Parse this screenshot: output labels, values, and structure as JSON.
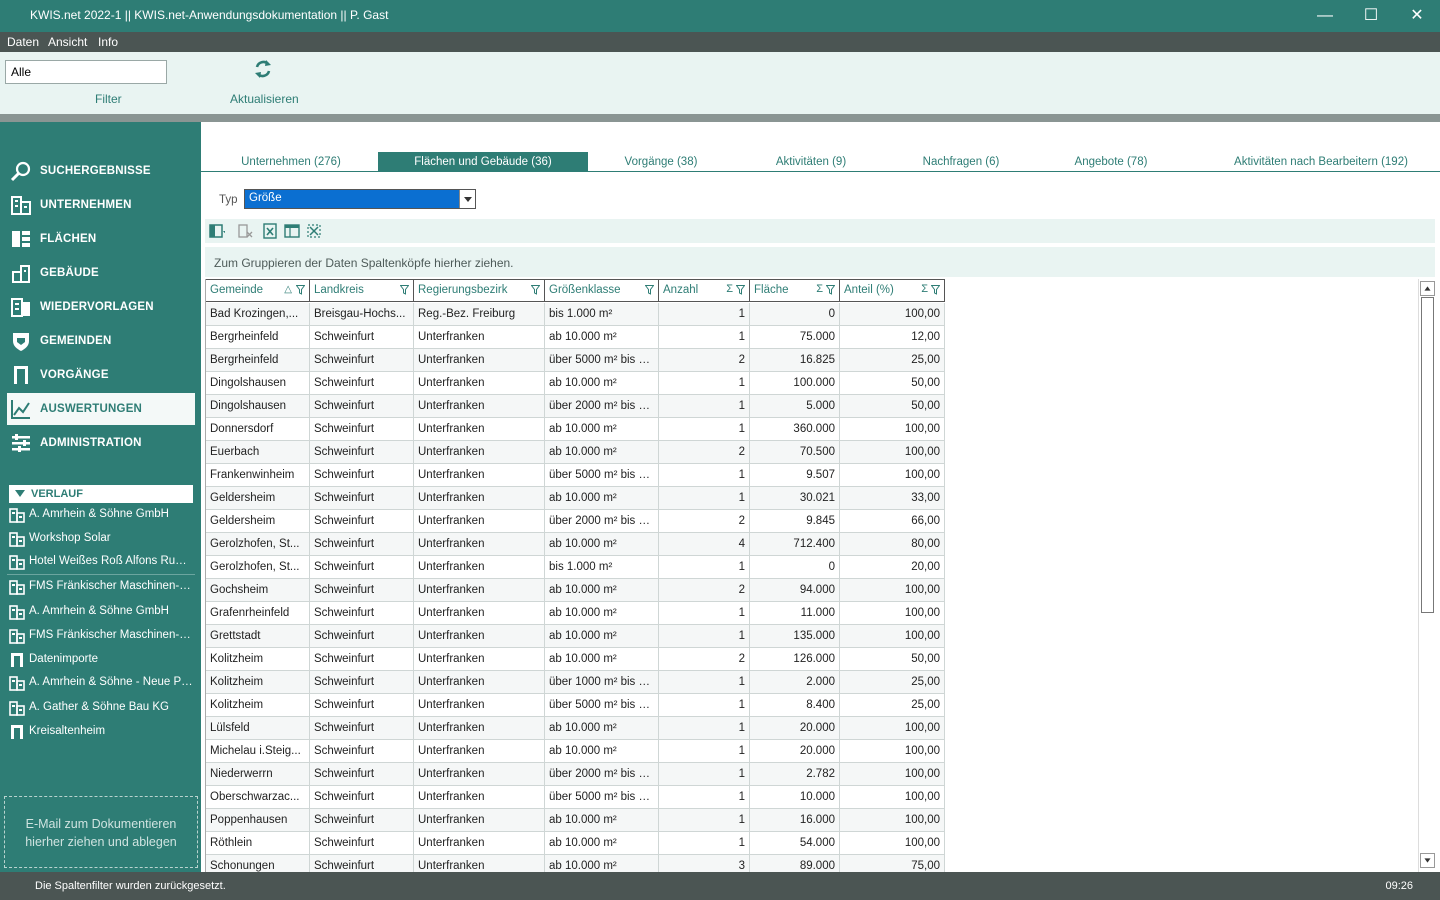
{
  "window": {
    "title": "KWIS.net 2022-1 || KWIS.net-Anwendungsdokumentation || P. Gast",
    "minimize": "—",
    "maximize": "☐",
    "close": "✕"
  },
  "menu": [
    "Daten",
    "Ansicht",
    "Info"
  ],
  "ribbon": {
    "filter_value": "Alle",
    "filter_label": "Filter",
    "refresh_label": "Aktualisieren",
    "refresh_icon": "refresh-icon"
  },
  "nav": [
    {
      "label": "SUCHERGEBNISSE",
      "icon": "search-icon"
    },
    {
      "label": "UNTERNEHMEN",
      "icon": "building-icon"
    },
    {
      "label": "FLÄCHEN",
      "icon": "area-icon"
    },
    {
      "label": "GEBÄUDE",
      "icon": "house-icon"
    },
    {
      "label": "WIEDERVORLAGEN",
      "icon": "resubmission-icon"
    },
    {
      "label": "GEMEINDEN",
      "icon": "crest-icon"
    },
    {
      "label": "VORGÄNGE",
      "icon": "door-icon"
    },
    {
      "label": "AUSWERTUNGEN",
      "icon": "chart-icon",
      "active": true
    },
    {
      "label": "ADMINISTRATION",
      "icon": "sliders-icon"
    }
  ],
  "history": {
    "title": "VERLAUF",
    "items": [
      {
        "label": "A. Amrhein & Söhne GmbH",
        "icon": "company-icon"
      },
      {
        "label": "Workshop Solar",
        "icon": "company-icon"
      },
      {
        "label": "Hotel Weißes Roß Alfons Rudlof",
        "icon": "company-icon"
      },
      {
        "label": "FMS Fränkischer Maschinen- und",
        "icon": "company-icon"
      },
      {
        "label": "A. Amrhein & Söhne GmbH",
        "icon": "company-icon"
      },
      {
        "label": "FMS Fränkischer Maschinen- und",
        "icon": "company-icon"
      },
      {
        "label": "Datenimporte",
        "icon": "door-icon"
      },
      {
        "label": "A. Amrhein & Söhne - Neue Projekte",
        "icon": "company-icon"
      },
      {
        "label": "A. Gather & Söhne Bau KG",
        "icon": "company-icon"
      },
      {
        "label": "Kreisaltenheim",
        "icon": "door-icon"
      }
    ]
  },
  "dropzone_text": "E-Mail  zum Dokumentieren hierher ziehen und ablegen",
  "tabs": [
    {
      "label": "Unternehmen (276)"
    },
    {
      "label": "Flächen und Gebäude (36)",
      "active": true
    },
    {
      "label": "Vorgänge (38)"
    },
    {
      "label": "Aktivitäten (9)"
    },
    {
      "label": "Nachfragen (6)"
    },
    {
      "label": "Angebote (78)"
    },
    {
      "label": "Aktivitäten nach Bearbeitern (192)"
    }
  ],
  "typ": {
    "label": "Typ",
    "value": "Größe"
  },
  "grid_toolbar_icons": [
    "column-chooser-icon",
    "clear-filter-icon",
    "excel-export-icon",
    "layout-icon",
    "fit-columns-icon"
  ],
  "groupbar_text": "Zum Gruppieren der Daten Spaltenköpfe hierher ziehen.",
  "columns": [
    {
      "label": "Gemeinde",
      "sort": "△"
    },
    {
      "label": "Landkreis"
    },
    {
      "label": "Regierungsbezirk"
    },
    {
      "label": "Größenklasse"
    },
    {
      "label": "Anzahl",
      "sum": "Σ"
    },
    {
      "label": "Fläche",
      "sum": "Σ"
    },
    {
      "label": "Anteil (%)",
      "sum": "Σ"
    }
  ],
  "rows": [
    [
      "Bad Krozingen,...",
      "Breisgau-Hochs...",
      "Reg.-Bez. Freiburg",
      "bis 1.000 m²",
      "1",
      "0",
      "100,00"
    ],
    [
      "Bergrheinfeld",
      "Schweinfurt",
      "Unterfranken",
      "ab 10.000 m²",
      "1",
      "75.000",
      "12,00"
    ],
    [
      "Bergrheinfeld",
      "Schweinfurt",
      "Unterfranken",
      "über 5000 m² bis 1...",
      "2",
      "16.825",
      "25,00"
    ],
    [
      "Dingolshausen",
      "Schweinfurt",
      "Unterfranken",
      "ab 10.000 m²",
      "1",
      "100.000",
      "50,00"
    ],
    [
      "Dingolshausen",
      "Schweinfurt",
      "Unterfranken",
      "über 2000 m² bis 5...",
      "1",
      "5.000",
      "50,00"
    ],
    [
      "Donnersdorf",
      "Schweinfurt",
      "Unterfranken",
      "ab 10.000 m²",
      "1",
      "360.000",
      "100,00"
    ],
    [
      "Euerbach",
      "Schweinfurt",
      "Unterfranken",
      "ab 10.000 m²",
      "2",
      "70.500",
      "100,00"
    ],
    [
      "Frankenwinheim",
      "Schweinfurt",
      "Unterfranken",
      "über 5000 m² bis 1...",
      "1",
      "9.507",
      "100,00"
    ],
    [
      "Geldersheim",
      "Schweinfurt",
      "Unterfranken",
      "ab 10.000 m²",
      "1",
      "30.021",
      "33,00"
    ],
    [
      "Geldersheim",
      "Schweinfurt",
      "Unterfranken",
      "über 2000 m² bis 5...",
      "2",
      "9.845",
      "66,00"
    ],
    [
      "Gerolzhofen, St...",
      "Schweinfurt",
      "Unterfranken",
      "ab 10.000 m²",
      "4",
      "712.400",
      "80,00"
    ],
    [
      "Gerolzhofen, St...",
      "Schweinfurt",
      "Unterfranken",
      "bis 1.000 m²",
      "1",
      "0",
      "20,00"
    ],
    [
      "Gochsheim",
      "Schweinfurt",
      "Unterfranken",
      "ab 10.000 m²",
      "2",
      "94.000",
      "100,00"
    ],
    [
      "Grafenrheinfeld",
      "Schweinfurt",
      "Unterfranken",
      "ab 10.000 m²",
      "1",
      "11.000",
      "100,00"
    ],
    [
      "Grettstadt",
      "Schweinfurt",
      "Unterfranken",
      "ab 10.000 m²",
      "1",
      "135.000",
      "100,00"
    ],
    [
      "Kolitzheim",
      "Schweinfurt",
      "Unterfranken",
      "ab 10.000 m²",
      "2",
      "126.000",
      "50,00"
    ],
    [
      "Kolitzheim",
      "Schweinfurt",
      "Unterfranken",
      "über 1000 m² bis 2...",
      "1",
      "2.000",
      "25,00"
    ],
    [
      "Kolitzheim",
      "Schweinfurt",
      "Unterfranken",
      "über 5000 m² bis 1...",
      "1",
      "8.400",
      "25,00"
    ],
    [
      "Lülsfeld",
      "Schweinfurt",
      "Unterfranken",
      "ab 10.000 m²",
      "1",
      "20.000",
      "100,00"
    ],
    [
      "Michelau i.Steig...",
      "Schweinfurt",
      "Unterfranken",
      "ab 10.000 m²",
      "1",
      "20.000",
      "100,00"
    ],
    [
      "Niederwerrn",
      "Schweinfurt",
      "Unterfranken",
      "über 2000 m² bis 5...",
      "1",
      "2.782",
      "100,00"
    ],
    [
      "Oberschwarzac...",
      "Schweinfurt",
      "Unterfranken",
      "über 5000 m² bis 1...",
      "1",
      "10.000",
      "100,00"
    ],
    [
      "Poppenhausen",
      "Schweinfurt",
      "Unterfranken",
      "ab 10.000 m²",
      "1",
      "16.000",
      "100,00"
    ],
    [
      "Röthlein",
      "Schweinfurt",
      "Unterfranken",
      "ab 10.000 m²",
      "1",
      "54.000",
      "100,00"
    ],
    [
      "Schonungen",
      "Schweinfurt",
      "Unterfranken",
      "ab 10.000 m²",
      "3",
      "89.000",
      "75,00"
    ]
  ],
  "status": {
    "message": "Die Spaltenfilter wurden zurückgesetzt.",
    "time": "09:26"
  }
}
